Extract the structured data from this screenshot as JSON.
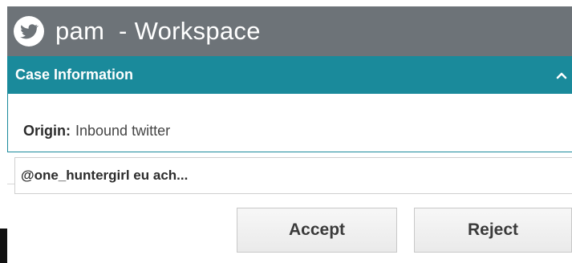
{
  "window": {
    "title": "pam  - Workspace",
    "app_icon": "twitter-bird-icon"
  },
  "case_section": {
    "header_label": "Case Information",
    "collapse_icon": "chevron-up-icon",
    "origin_label": "Origin:",
    "origin_value": "Inbound twitter"
  },
  "message": {
    "preview_text": "@one_huntergirl eu ach..."
  },
  "actions": {
    "accept_label": "Accept",
    "reject_label": "Reject"
  },
  "colors": {
    "titlebar": "#6d7378",
    "section_header": "#1a8a9b"
  }
}
